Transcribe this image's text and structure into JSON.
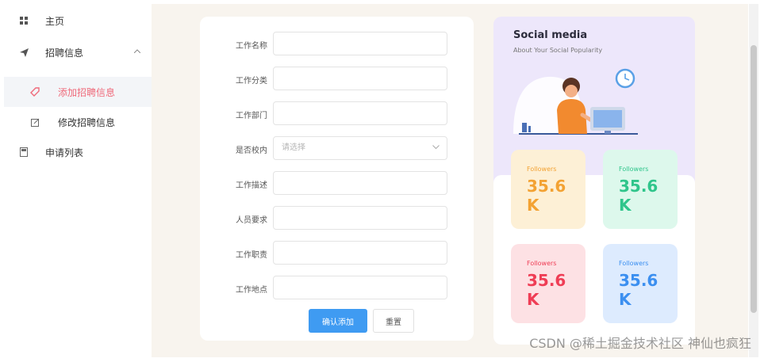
{
  "sidebar": {
    "items": [
      {
        "label": "主页",
        "icon": "grid-icon"
      },
      {
        "label": "招聘信息",
        "icon": "send-icon",
        "chevron": "^"
      },
      {
        "label": "添加招聘信息",
        "icon": "tag-icon",
        "active": true
      },
      {
        "label": "修改招聘信息",
        "icon": "edit-icon"
      },
      {
        "label": "申请列表",
        "icon": "document-icon"
      }
    ]
  },
  "form": {
    "fields": [
      {
        "label": "工作名称",
        "value": ""
      },
      {
        "label": "工作分类",
        "value": ""
      },
      {
        "label": "工作部门",
        "value": ""
      },
      {
        "label": "是否校内",
        "placeholder": "请选择",
        "type": "select"
      },
      {
        "label": "工作描述",
        "value": ""
      },
      {
        "label": "人员要求",
        "value": ""
      },
      {
        "label": "工作职责",
        "value": ""
      },
      {
        "label": "工作地点",
        "value": ""
      }
    ],
    "submit_label": "确认添加",
    "reset_label": "重置"
  },
  "social": {
    "title": "Social media",
    "subtitle": "About Your Social Popularity",
    "stats": [
      {
        "label": "Followers",
        "value": "35.6 K",
        "color": "#f3a233",
        "bg": "#fdf0d6"
      },
      {
        "label": "Followers",
        "value": "35.6 K",
        "color": "#2fc58b",
        "bg": "#ddf8ec"
      },
      {
        "label": "Followers",
        "value": "35.6 K",
        "color": "#ef3d55",
        "bg": "#fde1e4"
      },
      {
        "label": "Followers",
        "value": "35.6 K",
        "color": "#3b8ff0",
        "bg": "#ddebfe"
      }
    ]
  },
  "watermark": "CSDN @稀土掘金技术社区 神仙也疯狂",
  "colors": {
    "accent": "#3f9bf2",
    "active_menu": "#ef6a7a",
    "page_bg": "#f8f4ee"
  }
}
